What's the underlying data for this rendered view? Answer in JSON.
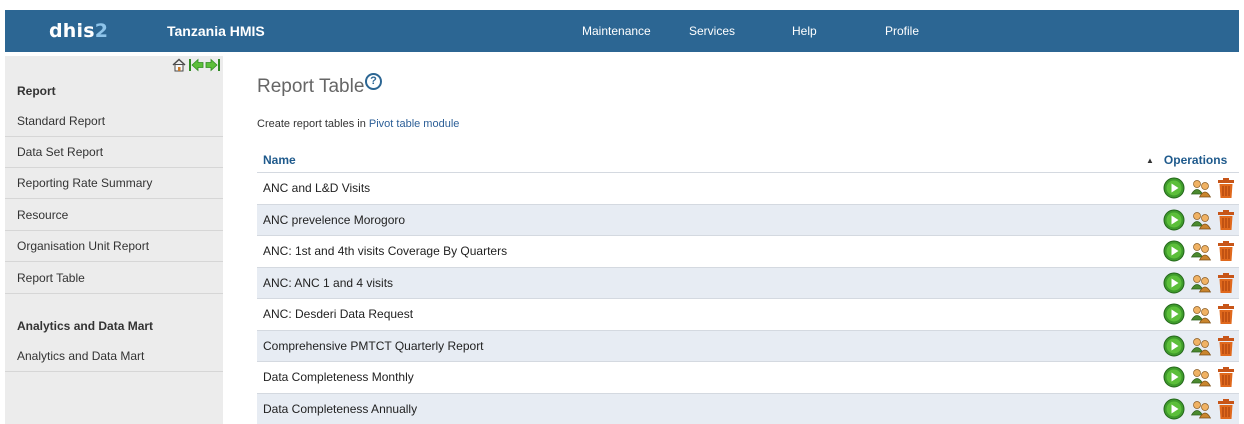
{
  "header": {
    "logo_main": "dhis",
    "logo_num": "2",
    "title": "Tanzania HMIS",
    "menu": [
      "Maintenance",
      "Services",
      "Help",
      "Profile"
    ]
  },
  "sidebar": {
    "nav_icons": [
      "home-icon",
      "back-arrow-icon",
      "forward-arrow-icon"
    ],
    "section1_title": "Report",
    "section1_items": [
      "Standard Report",
      "Data Set Report",
      "Reporting Rate Summary",
      "Resource",
      "Organisation Unit Report",
      "Report Table"
    ],
    "section2_title": "Analytics and Data Mart",
    "section2_items": [
      "Analytics and Data Mart"
    ]
  },
  "main": {
    "title": "Report Table",
    "help_symbol": "?",
    "intro_text": "Create report tables in ",
    "intro_link": "Pivot table module",
    "columns": {
      "name": "Name",
      "operations": "Operations",
      "sort_arrow": "▲"
    },
    "rows": [
      "ANC and L&D Visits",
      "ANC prevelence Morogoro",
      "ANC: 1st and 4th visits Coverage By Quarters",
      "ANC: ANC 1 and 4 visits",
      "ANC: Desderi Data Request",
      "Comprehensive PMTCT Quarterly Report",
      "Data Completeness Monthly",
      "Data Completeness Annually"
    ],
    "row_operation_icons": [
      "run-icon",
      "sharing-icon",
      "delete-icon"
    ]
  },
  "colors": {
    "header_bg": "#2c6693",
    "sidebar_bg": "#ececec",
    "link": "#1f5a8c",
    "row_alt": "#e7ecf3",
    "run_green": "#3f9b2c",
    "delete_orange": "#e0691d"
  }
}
